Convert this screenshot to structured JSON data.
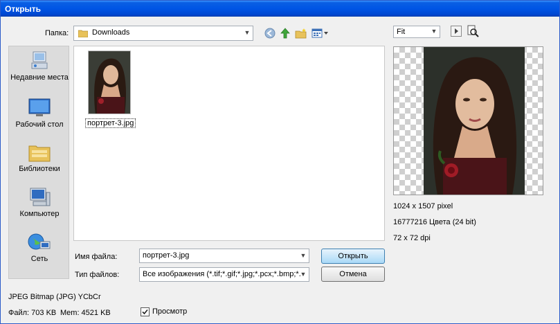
{
  "window": {
    "title": "Открыть"
  },
  "location": {
    "label": "Папка:",
    "current": "Downloads"
  },
  "places": [
    {
      "label": "Недавние места",
      "icon": "recent-places-icon"
    },
    {
      "label": "Рабочий стол",
      "icon": "desktop-icon"
    },
    {
      "label": "Библиотеки",
      "icon": "libraries-icon"
    },
    {
      "label": "Компьютер",
      "icon": "computer-icon"
    },
    {
      "label": "Сеть",
      "icon": "network-icon"
    }
  ],
  "files": [
    {
      "name": "портрет-3.jpg",
      "icon": "image-thumbnail"
    }
  ],
  "filename": {
    "label": "Имя файла:",
    "value": "портрет-3.jpg"
  },
  "filetype": {
    "label": "Тип файлов:",
    "value": "Все изображения (*.tif;*.gif;*.jpg;*.pcx;*.bmp;*."
  },
  "buttons": {
    "open": "Открыть",
    "cancel": "Отмена"
  },
  "zoom": {
    "value": "Fit"
  },
  "image_info": {
    "dimensions": "1024 x 1507 pixel",
    "colors": "16777216 Цвета (24 bit)",
    "dpi": "72 x 72 dpi"
  },
  "footer": {
    "format": "JPEG Bitmap (JPG) YCbCr",
    "file_size": "Файл: 703 KB",
    "mem": "Mem: 4521 KB",
    "preview_label": "Просмотр",
    "preview_checked": true
  }
}
